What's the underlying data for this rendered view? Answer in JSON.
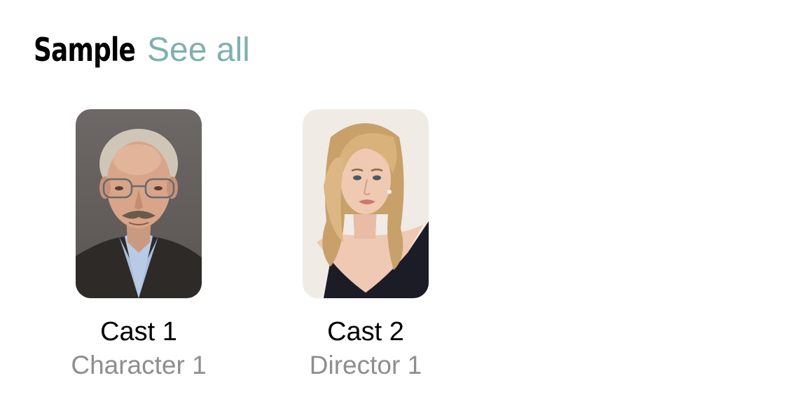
{
  "section": {
    "title": "Sample",
    "see_all_label": "See all"
  },
  "cast": [
    {
      "name": "Cast 1",
      "role": "Character 1",
      "photo_icon": "person-photo-man-glasses"
    },
    {
      "name": "Cast 2",
      "role": "Director 1",
      "photo_icon": "person-photo-woman-blonde"
    }
  ],
  "colors": {
    "accent": "#7fb0ae",
    "title": "#000000",
    "subtitle": "#8e8e8e",
    "background": "#ffffff"
  }
}
